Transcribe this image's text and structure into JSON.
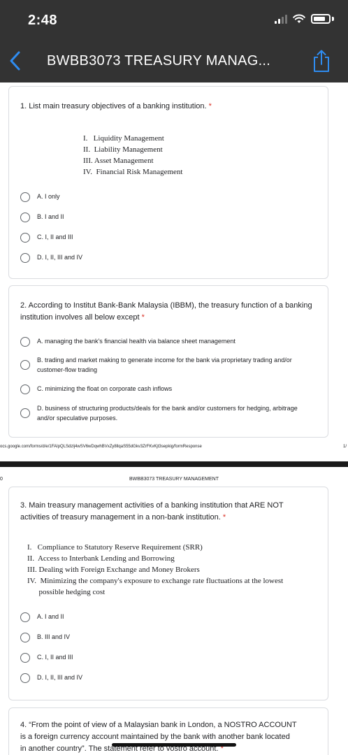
{
  "status": {
    "time": "2:48"
  },
  "nav": {
    "title": "BWBB3073 TREASURY MANAG..."
  },
  "questions": [
    {
      "text": "1. List main treasury objectives of a banking institution.",
      "required_mark": "*",
      "roman": [
        "I.   Liquidity Management",
        "II.  Liability Management",
        "III. Asset Management",
        "IV.  Financial Risk Management"
      ],
      "options": [
        "A. I only",
        "B. I and II",
        "C. I, II and III",
        "D. I, II, III and IV"
      ]
    },
    {
      "text": "2. According to Institut Bank-Bank Malaysia (IBBM), the treasury function of a banking institution involves all below except",
      "required_mark": "*",
      "options": [
        "A. managing the bank's financial health via balance sheet management",
        "B. trading and market making to generate income for the bank via proprietary trading and/or customer-flow trading",
        "C. minimizing the float on corporate cash inflows",
        "D. business of structuring products/deals for the bank and/or customers for hedging, arbitrage and/or speculative purposes."
      ]
    },
    {
      "text": "3. Main treasury management activities of a banking institution that ARE NOT activities of treasury management in a non-bank institution.",
      "required_mark": "*",
      "roman": [
        "I.   Compliance to Statutory Reserve Requirement (SRR)",
        "II.  Access to Interbank Lending and Borrowing",
        "III. Dealing with Foreign Exchange and Money Brokers",
        "IV.  Minimizing the company's exposure to exchange rate fluctuations at the lowest",
        "      possible hedging cost"
      ],
      "options": [
        "A. I and II",
        "B. III and IV",
        "C. I, II and III",
        "D. I, II, III and IV"
      ]
    },
    {
      "text_line1": "4. “From the point of view of a Malaysian bank in London, a NOSTRO ACCOUNT",
      "text_line2": "is a foreign currency account maintained by the bank with another bank located",
      "text_line3": "in another country”. The statement refer to vostro account.",
      "required_mark": "*"
    }
  ],
  "print": {
    "url": "ocs.google.com/forms/d/e/1FAIpQLSdzlj4wSV6wDqwhBVxZy8llqaS55dGkv3ZrFKvKjt3sepkig/formResponse",
    "page_number": "1/",
    "page_header": "BWBB3073 TREASURY MANAGEMENT",
    "left_mark": "0"
  }
}
